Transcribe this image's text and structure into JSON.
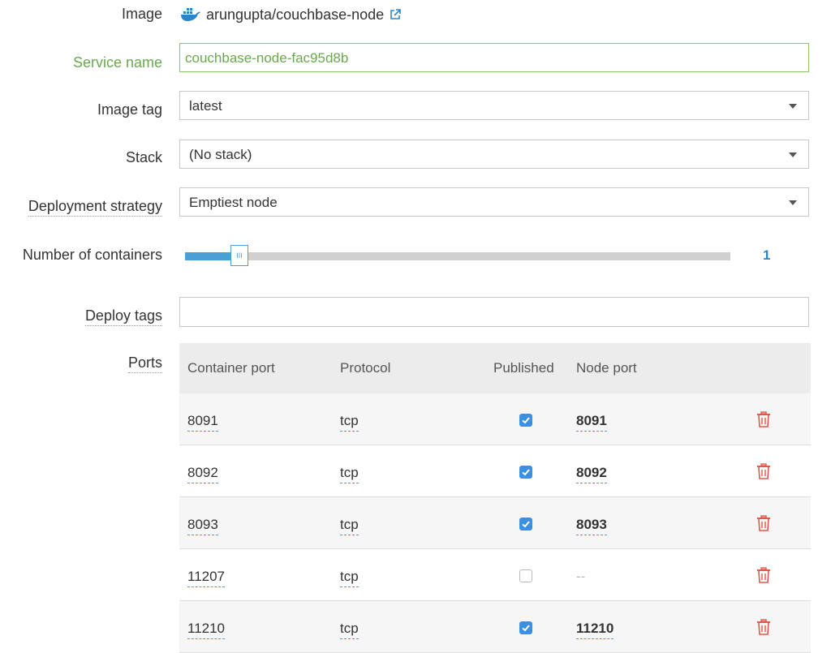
{
  "image": {
    "label": "Image",
    "value": "arungupta/couchbase-node",
    "icon": "docker-whale-icon",
    "link_icon": "external-link-icon"
  },
  "service_name": {
    "label": "Service name",
    "value": "couchbase-node-fac95d8b"
  },
  "image_tag": {
    "label": "Image tag",
    "value": "latest"
  },
  "stack": {
    "label": "Stack",
    "value": "(No stack)"
  },
  "deployment_strategy": {
    "label": "Deployment strategy",
    "value": "Emptiest node"
  },
  "containers": {
    "label": "Number of containers",
    "value": "1",
    "slider_fraction": 0.1
  },
  "deploy_tags": {
    "label": "Deploy tags",
    "value": ""
  },
  "ports": {
    "label": "Ports",
    "headers": {
      "container_port": "Container port",
      "protocol": "Protocol",
      "published": "Published",
      "node_port": "Node port"
    },
    "rows": [
      {
        "container_port": "8091",
        "protocol": "tcp",
        "published": true,
        "node_port": "8091"
      },
      {
        "container_port": "8092",
        "protocol": "tcp",
        "published": true,
        "node_port": "8092"
      },
      {
        "container_port": "8093",
        "protocol": "tcp",
        "published": true,
        "node_port": "8093"
      },
      {
        "container_port": "11207",
        "protocol": "tcp",
        "published": false,
        "node_port": "--"
      },
      {
        "container_port": "11210",
        "protocol": "tcp",
        "published": true,
        "node_port": "11210"
      }
    ]
  },
  "colors": {
    "accent": "#4a9fd4",
    "valid": "#6aa84f",
    "checkbox": "#3d8fe0",
    "delete": "#e05a4a"
  }
}
